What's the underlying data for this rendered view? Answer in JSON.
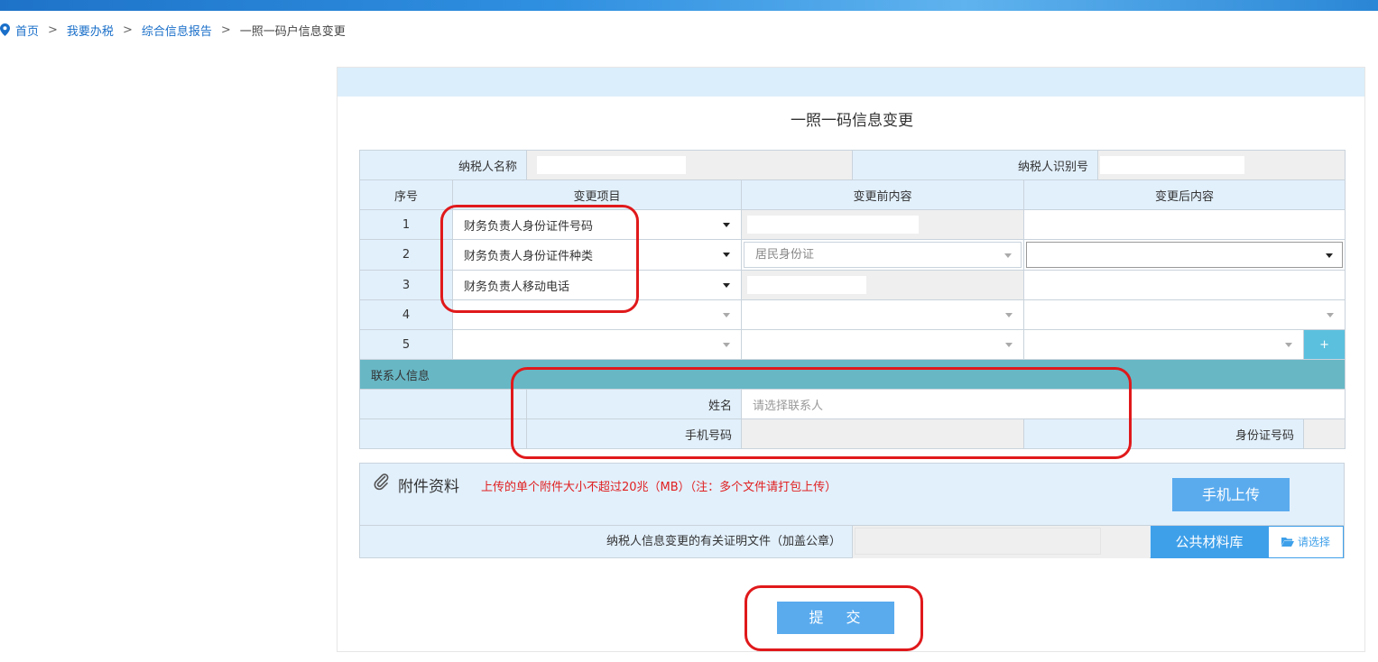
{
  "breadcrumb": {
    "items": [
      "首页",
      "我要办税",
      "综合信息报告"
    ],
    "current": "一照一码户信息变更",
    "sep": ">"
  },
  "form": {
    "title": "一照一码信息变更",
    "taxpayer_name_label": "纳税人名称",
    "taxpayer_id_label": "纳税人识别号",
    "headers": {
      "seq": "序号",
      "item": "变更项目",
      "before": "变更前内容",
      "after": "变更后内容"
    },
    "rows": [
      {
        "seq": "1",
        "item": "财务负责人身份证件号码"
      },
      {
        "seq": "2",
        "item": "财务负责人身份证件种类",
        "before": "居民身份证"
      },
      {
        "seq": "3",
        "item": "财务负责人移动电话"
      },
      {
        "seq": "4",
        "item": ""
      },
      {
        "seq": "5",
        "item": ""
      }
    ],
    "add_button": "+",
    "contact_section": "联系人信息",
    "contact_name_label": "姓名",
    "contact_name_placeholder": "请选择联系人",
    "contact_phone_label": "手机号码",
    "contact_idno_label": "身份证号码"
  },
  "attachments": {
    "title": "附件资料",
    "note": "上传的单个附件大小不超过20兆（MB）（注：多个文件请打包上传）",
    "mobile_upload": "手机上传",
    "doc_label": "纳税人信息变更的有关证明文件（加盖公章）",
    "library_button": "公共材料库",
    "choose_button": "请选择"
  },
  "submit_button": "提 交",
  "colors": {
    "accent": "#5aabee",
    "section": "#68b7c5",
    "header_bg": "#e2f0fc",
    "annotation": "#e0191b"
  }
}
